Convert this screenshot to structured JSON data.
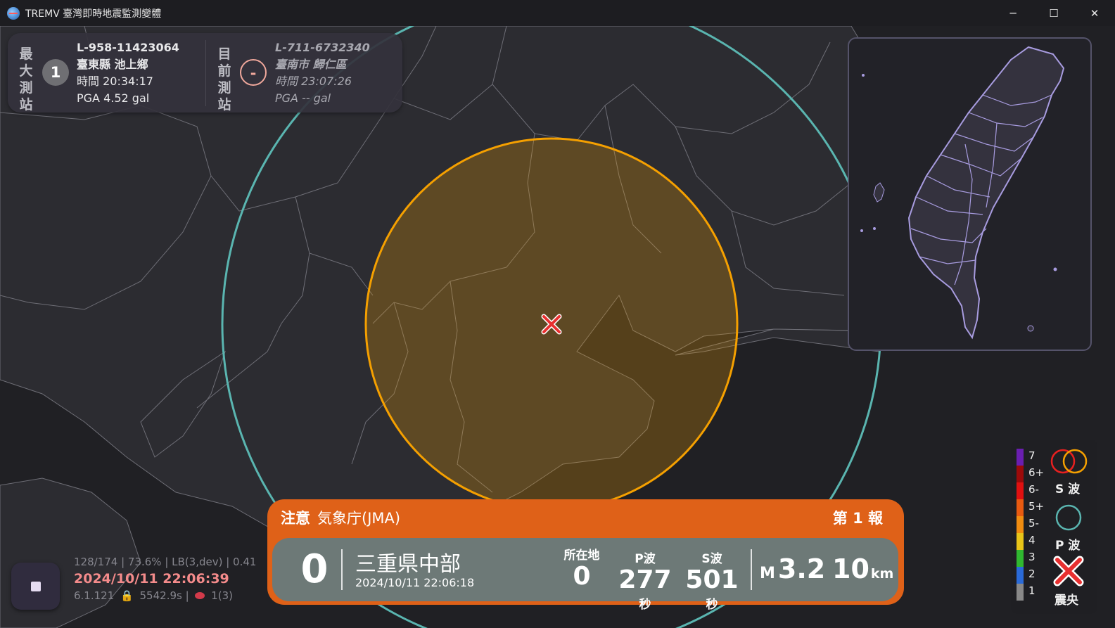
{
  "window": {
    "title": "TREMV 臺灣即時地震監測變體",
    "minimize_glyph": "─",
    "maximize_glyph": "☐",
    "close_glyph": "✕"
  },
  "stations": {
    "max": {
      "label_chars": [
        "最",
        "大",
        "測",
        "站"
      ],
      "intensity": "1",
      "id": "L-958-11423064",
      "location": "臺東縣 池上鄉",
      "time": "時間 20:34:17",
      "pga": "PGA 4.52 gal"
    },
    "current": {
      "label_chars": [
        "目",
        "前",
        "測",
        "站"
      ],
      "intensity": "-",
      "id": "L-711-6732340",
      "location": "臺南市 歸仁區",
      "time": "時間 23:07:26",
      "pga": "PGA -- gal"
    }
  },
  "legend": {
    "scale": [
      {
        "label": "7",
        "color": "#6a1eb0"
      },
      {
        "label": "6+",
        "color": "#9c0a0a"
      },
      {
        "label": "6-",
        "color": "#e01010"
      },
      {
        "label": "5+",
        "color": "#e85a10"
      },
      {
        "label": "5-",
        "color": "#f08c10"
      },
      {
        "label": "4",
        "color": "#e8c418"
      },
      {
        "label": "3",
        "color": "#30b830"
      },
      {
        "label": "2",
        "color": "#2a6ad8"
      },
      {
        "label": "1",
        "color": "#888888"
      }
    ],
    "s_wave_label": "S 波",
    "p_wave_label": "P 波",
    "epicenter_label": "震央",
    "colors": {
      "s_wave_red": "#e82020",
      "s_wave_orange": "#f5a000",
      "p_wave": "#5ab5b0",
      "epicenter": "#e83030"
    }
  },
  "status": {
    "line1": "128/174 | 73.6% | LB(3,dev) | 0.41",
    "time": "2024/10/11 22:06:39",
    "version": "6.1.121",
    "uptime": "5542.9s |",
    "connections": "1(3)"
  },
  "eew": {
    "level": "注意",
    "source": "気象庁(JMA)",
    "report": "第 1 報",
    "intensity": "0",
    "location": "三重県中部",
    "time": "2024/10/11 22:06:18",
    "local_label": "所在地",
    "local_value": "0",
    "p_label": "P波",
    "p_value": "277",
    "s_label": "S波",
    "s_value": "501",
    "sec_unit": "秒",
    "mag_prefix": "M",
    "magnitude": "3.2",
    "depth": "10",
    "depth_unit": "km",
    "color_header": "#df6118",
    "color_body": "#6d7977"
  }
}
